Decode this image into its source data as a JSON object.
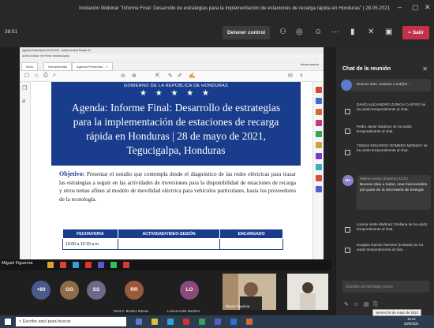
{
  "window": {
    "title": "Invitación Webinar \"Informe Final: Desarrollo de estrategias para la implementación de estaciones de recarga rápida en Honduras\" | 28.05.2021"
  },
  "meeting": {
    "elapsed": "38:51",
    "stop_control_label": "Detener control",
    "leave_label": "Salir"
  },
  "pdf": {
    "window_title": "Agenda Presentación 25.05.2021 - Adobe Acrobat Reader DC",
    "menu": "Archivo  Edición  Ver  Firmar  Ventana  Ayuda",
    "tabs": [
      "Inicio",
      "Herramientas",
      "Agenda Presentac... ×"
    ],
    "sign_in_label": "Iniciar sesión",
    "gov_header": "GOBIERNO DE LA REPÚBLICA DE HONDURAS",
    "stars": "★ ★ ★ ★ ★",
    "agenda_lines": [
      "Agenda: Informe Final: Desarrollo de estrategias",
      "para la implementación de estaciones de recarga",
      "rápida en Honduras | 28 de mayo de 2021,",
      "Tegucigalpa, Honduras"
    ],
    "objective_label": "Objetivo:",
    "objective_text": "Presentar el estudio que contempla desde el diagnóstico de las redes eléctricas para trazar las estrategias a seguir en las actividades de inversiones para la disponibilidad de estaciones de recarga y otros temas afines al modelo de movilidad eléctrica para vehículos particulares, hasta los proveedores de la tecnología.",
    "table_headers": [
      "FECHA/HORA",
      "ACTIVIDAD/VIDEO-SESIÓN",
      "ENCARGADO"
    ],
    "table_first_cell": "10:00 a 10:10 a.m."
  },
  "presenter": {
    "name": "Miguel Figueroa"
  },
  "participants": {
    "overflow": "+60",
    "avatars": [
      {
        "initials": "GG",
        "color": "#8f6b4a"
      },
      {
        "initials": "SS",
        "color": "#6a6a8a"
      },
      {
        "initials": "RR",
        "color": "#9a5a3a",
        "name": "Rene F. Benitez Ramos"
      },
      {
        "initials": "LO",
        "color": "#8a4a7a",
        "name": "Lorena Ivette Martinez"
      }
    ],
    "video_name": "Miguel Figueroa"
  },
  "chat": {
    "title": "Chat de la reunión",
    "messages": [
      {
        "type": "user",
        "text": "Buenos días, Saludos a tod@s!..."
      },
      {
        "type": "system",
        "text": "DAVID ALEJANDRO ZUNIGA CASTRO se ha unido temporalmente al chat."
      },
      {
        "type": "system",
        "text": "Pedro Javier Martinez se ha unido temporalmente al chat."
      },
      {
        "type": "system",
        "text": "TOMAS EDUARDO ROMERO MONDAY se ha unido temporalmente al chat."
      },
      {
        "type": "user",
        "sender": "Melina Arorijo (Externo)",
        "time": "10:10",
        "initials": "MA",
        "text": "Buenos días a todos, sean bienvenidos por parte de la Secretaría de Energía"
      },
      {
        "type": "system",
        "text": "Lorena Ivette Martinez Orellana se ha unido temporalmente al chat."
      },
      {
        "type": "system",
        "text": "Douglas Ramon Ramirez (Invitado) se ha unido temporalmente al chat."
      }
    ],
    "compose_placeholder": "Escribe un mensaje nuevo"
  },
  "taskbar": {
    "search_placeholder": "Escribe aquí para buscar",
    "time": "10:12",
    "date": "28/5/2021",
    "tooltip": "viernes 28 de mayo de 2021"
  }
}
